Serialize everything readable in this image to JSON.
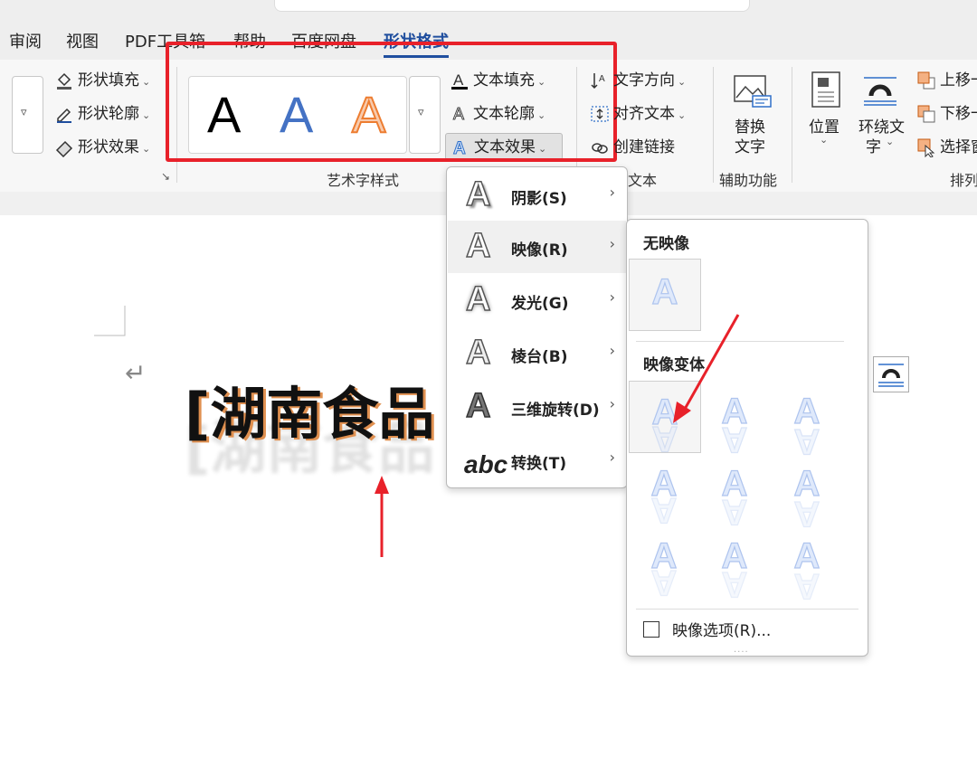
{
  "tabs": [
    {
      "label": "审阅"
    },
    {
      "label": "视图"
    },
    {
      "label": "PDF工具箱"
    },
    {
      "label": "帮助"
    },
    {
      "label": "百度网盘"
    },
    {
      "label": "形状格式",
      "active": true
    }
  ],
  "ribbon": {
    "shape_styles": {
      "fill": "形状填充",
      "outline": "形状轮廓",
      "effects": "形状效果"
    },
    "wordart": {
      "gallery": [
        "A",
        "A",
        "A"
      ],
      "text_fill": "文本填充",
      "text_outline": "文本轮廓",
      "text_effects": "文本效果",
      "group_label": "艺术字样式"
    },
    "text_group": {
      "direction": "文字方向",
      "align": "对齐文本",
      "link": "创建链接",
      "group_label": "文本"
    },
    "accessibility": {
      "alt_text_line1": "替换",
      "alt_text_line2": "文字",
      "group_label": "辅助功能"
    },
    "arrange": {
      "position": "位置",
      "wrap_line1": "环绕文",
      "wrap_line2": "字",
      "bring_forward": "上移一",
      "send_backward": "下移一",
      "select_pane": "选择窗",
      "group_label": "排列"
    }
  },
  "document": {
    "title_text": "[湖南食品"
  },
  "text_effects_menu": [
    {
      "label": "阴影(S)",
      "glyph": "A"
    },
    {
      "label": "映像(R)",
      "glyph": "A",
      "highlighted": true
    },
    {
      "label": "发光(G)",
      "glyph": "A"
    },
    {
      "label": "棱台(B)",
      "glyph": "A"
    },
    {
      "label": "三维旋转(D)",
      "glyph": "A"
    },
    {
      "label": "转换(T)",
      "glyph": "abc"
    }
  ],
  "reflection_menu": {
    "no_reflection_header": "无映像",
    "variations_header": "映像变体",
    "options_label": "映像选项(R)...",
    "glyph": "A"
  },
  "colors": {
    "accent_red": "#e8212a",
    "active_tab": "#1f4e9e",
    "wordart_blue": "#4472c4",
    "wordart_orange": "#f4b183"
  }
}
